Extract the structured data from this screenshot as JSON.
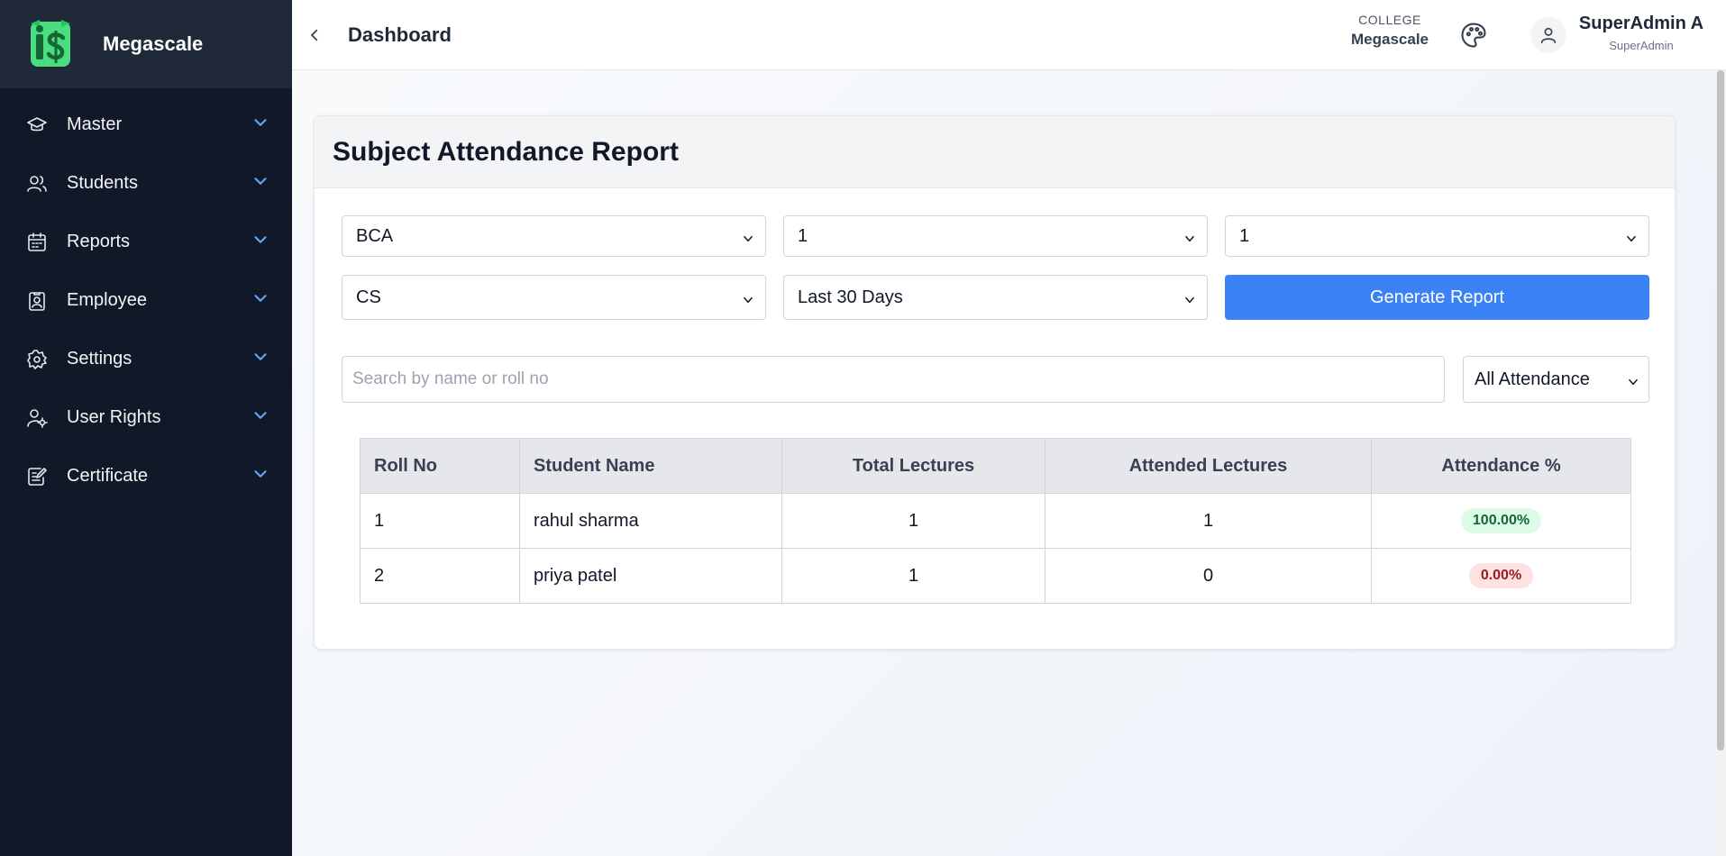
{
  "brand": {
    "name": "Megascale",
    "logo_icon": "megascale-logo-icon"
  },
  "sidebar": {
    "items": [
      {
        "label": "Master",
        "icon": "graduation-cap-icon"
      },
      {
        "label": "Students",
        "icon": "users-icon"
      },
      {
        "label": "Reports",
        "icon": "calendar-report-icon"
      },
      {
        "label": "Employee",
        "icon": "id-badge-icon"
      },
      {
        "label": "Settings",
        "icon": "gear-icon"
      },
      {
        "label": "User Rights",
        "icon": "user-gear-icon"
      },
      {
        "label": "Certificate",
        "icon": "certificate-edit-icon"
      }
    ]
  },
  "header": {
    "title": "Dashboard",
    "college_label": "COLLEGE",
    "college_name": "Megascale",
    "user_name": "SuperAdmin A",
    "user_role": "SuperAdmin"
  },
  "report": {
    "title": "Subject Attendance Report",
    "filters": {
      "course": "BCA",
      "year": "1",
      "semester": "1",
      "subject": "CS",
      "period": "Last 30 Days",
      "attendance_filter": "All Attendance"
    },
    "generate_label": "Generate Report",
    "search_placeholder": "Search by name or roll no",
    "columns": [
      "Roll No",
      "Student Name",
      "Total Lectures",
      "Attended Lectures",
      "Attendance %"
    ],
    "rows": [
      {
        "roll": "1",
        "name": "rahul sharma",
        "total": "1",
        "attended": "1",
        "percent": "100.00%",
        "status": "good"
      },
      {
        "roll": "2",
        "name": "priya patel",
        "total": "1",
        "attended": "0",
        "percent": "0.00%",
        "status": "bad"
      }
    ]
  },
  "colors": {
    "accent": "#3b82f6",
    "sidebar_bg": "#111827",
    "good": "#166534",
    "bad": "#991b1b"
  }
}
